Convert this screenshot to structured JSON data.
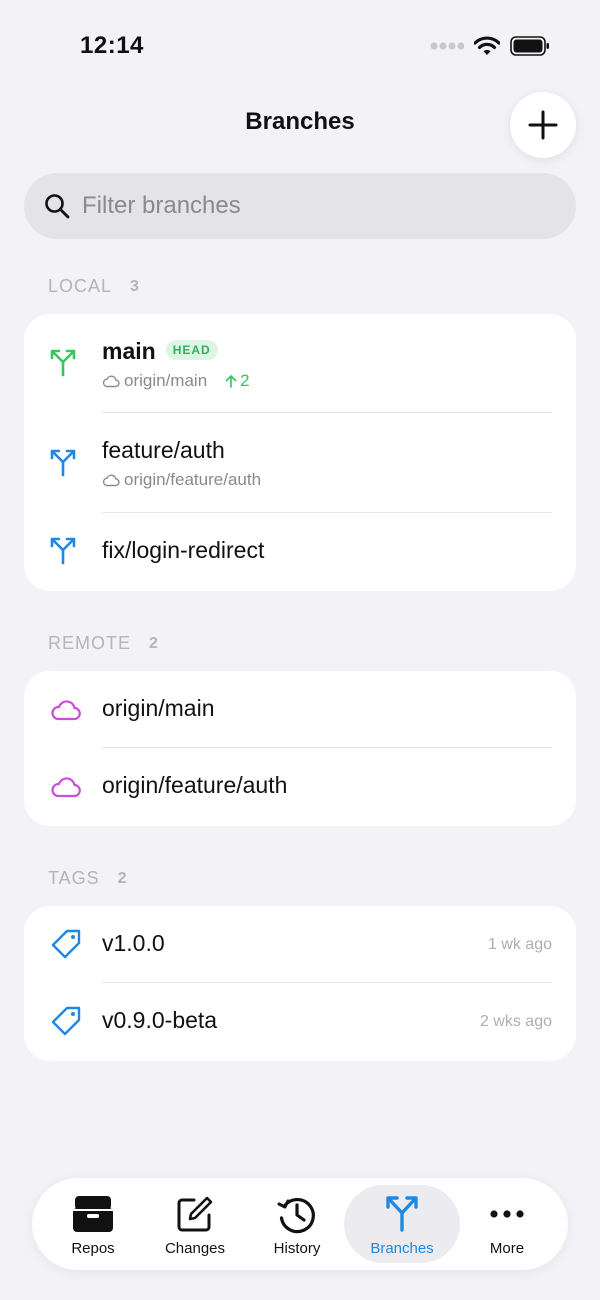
{
  "status_bar": {
    "time": "12:14"
  },
  "header": {
    "title": "Branches"
  },
  "search": {
    "placeholder": "Filter branches"
  },
  "sections": {
    "local": {
      "label": "LOCAL",
      "count": "3"
    },
    "remote": {
      "label": "REMOTE",
      "count": "2"
    },
    "tags": {
      "label": "TAGS",
      "count": "2"
    }
  },
  "local_branches": [
    {
      "name": "main",
      "badge": "HEAD",
      "upstream": "origin/main",
      "ahead": "2"
    },
    {
      "name": "feature/auth",
      "upstream": "origin/feature/auth"
    },
    {
      "name": "fix/login-redirect"
    }
  ],
  "remote_branches": [
    {
      "name": "origin/main"
    },
    {
      "name": "origin/feature/auth"
    }
  ],
  "tags": [
    {
      "name": "v1.0.0",
      "age": "1 wk ago"
    },
    {
      "name": "v0.9.0-beta",
      "age": "2 wks ago"
    }
  ],
  "tab_bar": {
    "tabs": [
      {
        "label": "Repos",
        "icon": "archive-box-icon"
      },
      {
        "label": "Changes",
        "icon": "compose-icon"
      },
      {
        "label": "History",
        "icon": "history-clock-icon"
      },
      {
        "label": "Branches",
        "icon": "branch-icon",
        "active": true
      },
      {
        "label": "More",
        "icon": "ellipsis-icon"
      }
    ]
  },
  "colors": {
    "accent": "#1E88E5",
    "head_branch": "#34C759",
    "remote": "#C94FD8",
    "background": "#F2F2F7"
  }
}
